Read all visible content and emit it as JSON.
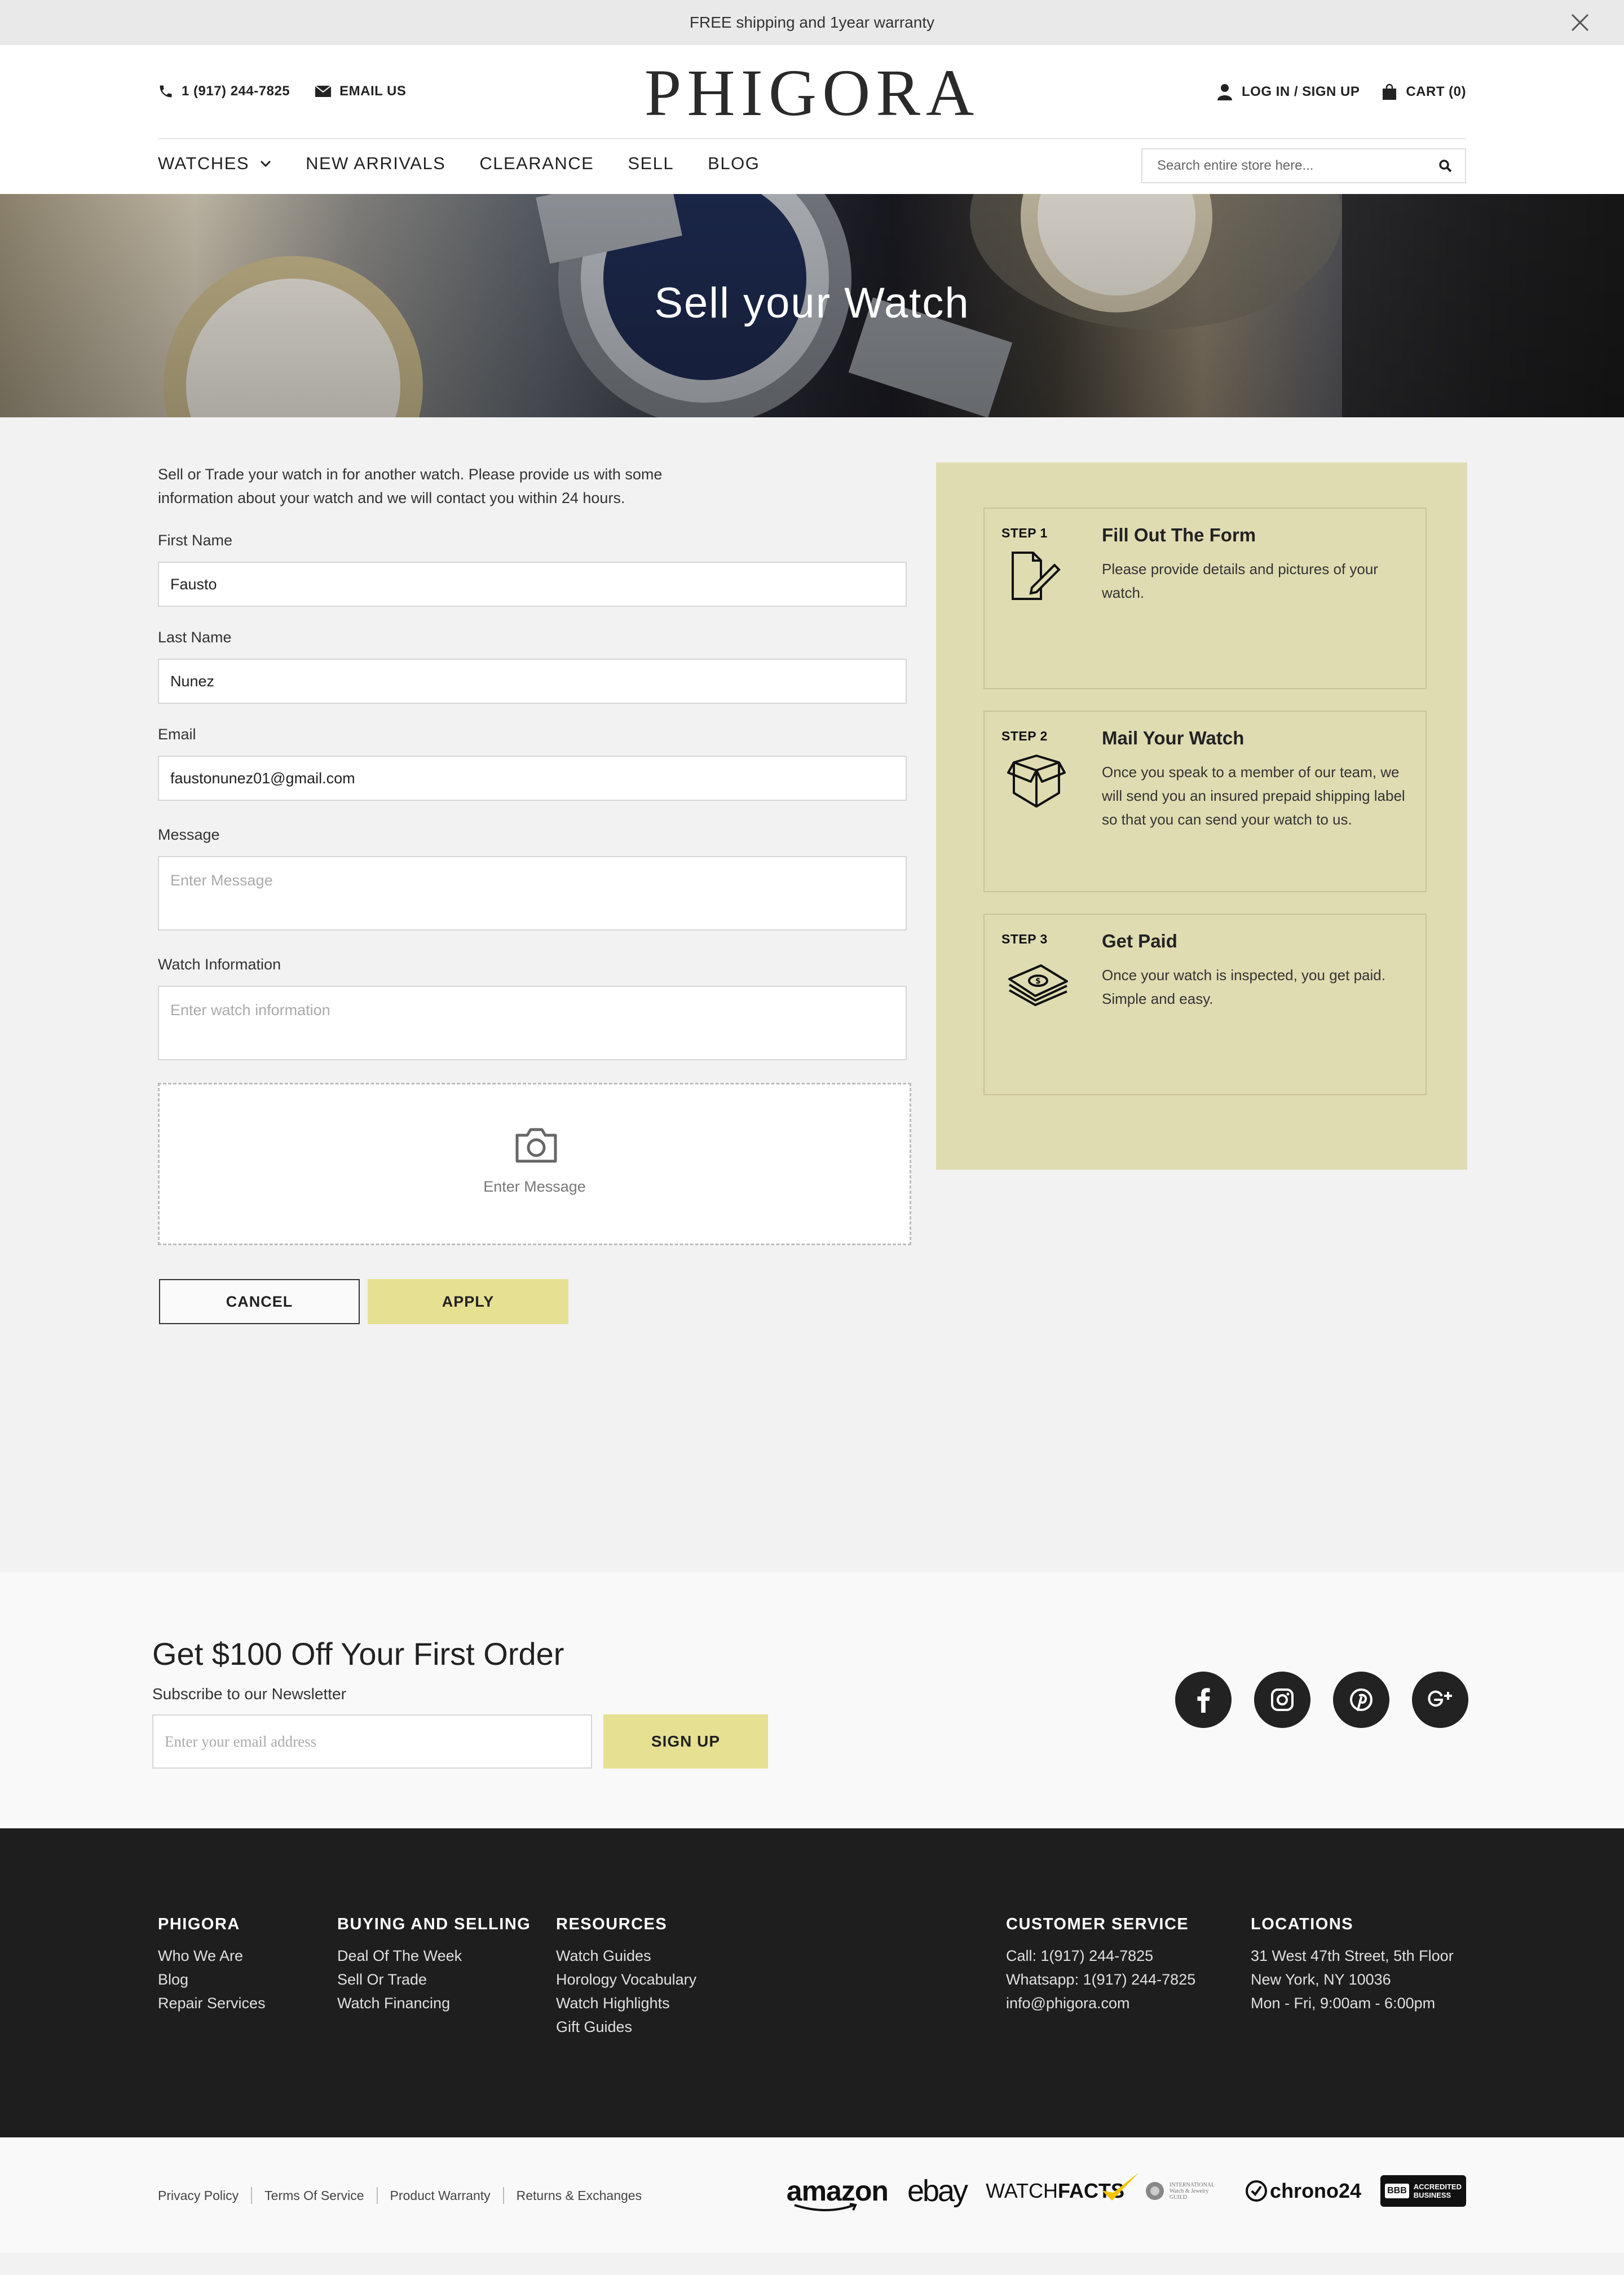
{
  "announcement": {
    "text": "FREE shipping and  1year warranty"
  },
  "header": {
    "phone": "1 (917) 244-7825",
    "email_label": "EMAIL US",
    "logo": "PHIGORA",
    "login_label": "LOG IN / SIGN UP",
    "cart_label": "CART (0)"
  },
  "nav": {
    "items": [
      {
        "label": "WATCHES"
      },
      {
        "label": "NEW ARRIVALS"
      },
      {
        "label": "CLEARANCE"
      },
      {
        "label": "SELL"
      },
      {
        "label": "BLOG"
      }
    ],
    "search_placeholder": "Search entire store here..."
  },
  "hero": {
    "title": "Sell your Watch"
  },
  "form": {
    "intro": "Sell or Trade your watch in for another watch. Please provide us with some information about your watch and we will contact you within 24 hours.",
    "first_name": {
      "label": "First Name",
      "value": "Fausto"
    },
    "last_name": {
      "label": "Last Name",
      "value": "Nunez"
    },
    "email": {
      "label": "Email",
      "value": "faustonunez01@gmail.com"
    },
    "message": {
      "label": "Message",
      "placeholder": "Enter Message"
    },
    "watch_info": {
      "label": "Watch Information",
      "placeholder": "Enter watch information"
    },
    "upload_text": "Enter Message",
    "cancel_label": "CANCEL",
    "apply_label": "APPLY"
  },
  "steps": [
    {
      "num": "STEP 1",
      "title": "Fill Out The Form",
      "desc": "Please provide details and pictures of your watch.",
      "icon": "form-pencil-icon"
    },
    {
      "num": "STEP 2",
      "title": "Mail Your Watch",
      "desc": "Once you speak to a member of our team, we will send you an insured prepaid shipping label so that you can send your watch to us.",
      "icon": "box-icon"
    },
    {
      "num": "STEP 3",
      "title": "Get Paid",
      "desc": "Once your watch is inspected, you get paid. Simple and easy.",
      "icon": "cash-icon"
    }
  ],
  "newsletter": {
    "title": "Get $100 Off Your First Order",
    "subtitle": "Subscribe to our Newsletter",
    "placeholder": "Enter your email address",
    "button": "SIGN UP",
    "social": [
      "facebook-icon",
      "instagram-icon",
      "pinterest-icon",
      "google-plus-icon"
    ]
  },
  "footer": {
    "columns": [
      {
        "heading": "PHIGORA",
        "links": [
          "Who We Are",
          "Blog",
          "Repair Services"
        ]
      },
      {
        "heading": "BUYING AND SELLING",
        "links": [
          "Deal Of The Week",
          "Sell Or Trade",
          "Watch Financing"
        ]
      },
      {
        "heading": "RESOURCES",
        "links": [
          "Watch Guides",
          "Horology Vocabulary",
          "Watch Highlights",
          "Gift Guides"
        ]
      },
      {
        "heading": "CUSTOMER SERVICE",
        "links": [
          "Call: 1(917) 244-7825",
          "Whatsapp: 1(917) 244-7825",
          "info@phigora.com"
        ]
      },
      {
        "heading": "LOCATIONS",
        "links": [
          "31 West 47th Street, 5th Floor",
          "New York, NY 10036",
          "Mon - Fri, 9:00am - 6:00pm"
        ]
      }
    ]
  },
  "bottom": {
    "legal": [
      "Privacy Policy",
      "Terms Of Service",
      "Product Warranty",
      "Returns & Exchanges"
    ],
    "partners": {
      "amazon": "amazon",
      "ebay": "ebay",
      "watchfacts_a": "WATCH",
      "watchfacts_b": "FACTS",
      "iwjg": "INTERNATIONAL Watch & Jewelry GUILD",
      "chrono": "chrono24",
      "bbb_a": "ACCREDITED",
      "bbb_b": "BUSINESS",
      "bbb_mark": "BBB"
    }
  },
  "colors": {
    "accent": "#e6e093",
    "steps_bg": "#e0dcb2",
    "footer_bg": "#1e1e1e"
  }
}
